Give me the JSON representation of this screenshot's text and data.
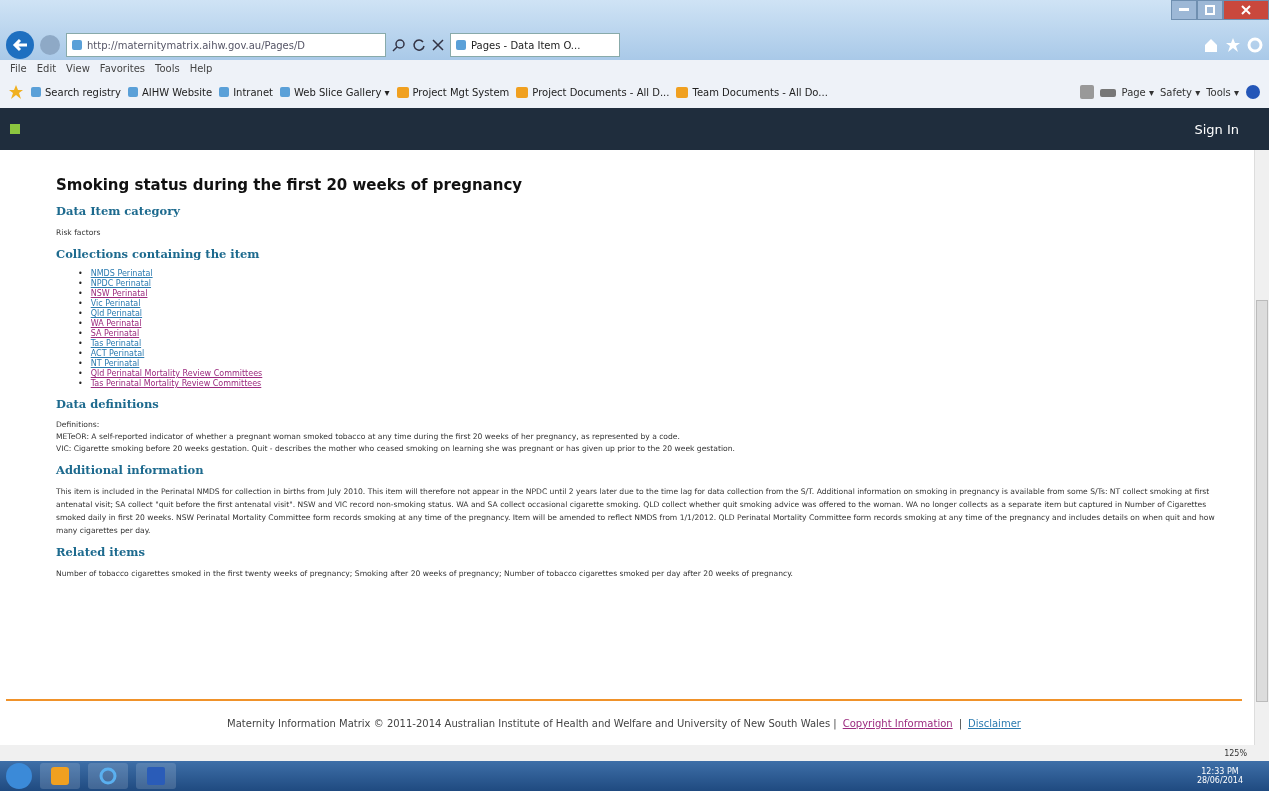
{
  "browser": {
    "address": "http://maternitymatrix.aihw.gov.au/Pages/D",
    "tab": {
      "label": "Pages - Data Item O...",
      "selected": true
    },
    "menu": [
      "File",
      "Edit",
      "View",
      "Favorites",
      "Tools",
      "Help"
    ],
    "favorites": [
      {
        "label": "Search registry",
        "kind": "page"
      },
      {
        "label": "AIHW Website",
        "kind": "page"
      },
      {
        "label": "Intranet",
        "kind": "page"
      },
      {
        "label": "Web Slice Gallery ▾",
        "kind": "page"
      },
      {
        "label": "Project Mgt System",
        "kind": "site"
      },
      {
        "label": "Project Documents - All D...",
        "kind": "site"
      },
      {
        "label": "Team Documents - All Do...",
        "kind": "site"
      }
    ],
    "commands": [
      "Page ▾",
      "Safety ▾",
      "Tools ▾"
    ]
  },
  "site_header": {
    "sign_in": "Sign In"
  },
  "page": {
    "title": "Smoking status during the first 20 weeks of pregnancy",
    "sections": [
      {
        "heading": "Data Item category",
        "kind": "text",
        "paragraphs": [
          "Risk factors"
        ]
      },
      {
        "heading": "Collections containing the item",
        "kind": "links",
        "bullet": "•",
        "links": [
          {
            "label": "NMDS Perinatal",
            "visited": false
          },
          {
            "label": "NPDC Perinatal",
            "visited": false
          },
          {
            "label": "NSW Perinatal",
            "visited": true
          },
          {
            "label": "Vic Perinatal",
            "visited": false
          },
          {
            "label": "Qld Perinatal",
            "visited": false
          },
          {
            "label": "WA Perinatal",
            "visited": true
          },
          {
            "label": "SA Perinatal",
            "visited": true
          },
          {
            "label": "Tas Perinatal",
            "visited": false
          },
          {
            "label": "ACT Perinatal",
            "visited": false
          },
          {
            "label": "NT Perinatal",
            "visited": false
          },
          {
            "label": "Qld Perinatal Mortality Review Committees",
            "visited": true
          },
          {
            "label": "Tas Perinatal Mortality Review Committees",
            "visited": true
          }
        ]
      },
      {
        "heading": "Data definitions",
        "kind": "lines",
        "paragraphs": [
          "Definitions:",
          "METeOR: A self-reported indicator of whether a pregnant woman smoked tobacco at any time during the first 20 weeks of her pregnancy, as represented by a code.",
          "VIC: Cigarette smoking before 20 weeks gestation. Quit - describes the mother who ceased smoking on learning she was pregnant or has given up prior to the 20 week gestation."
        ]
      },
      {
        "heading": "Additional information",
        "kind": "text",
        "paragraphs": [
          "This item is included in the Perinatal NMDS for collection in births from July 2010. This item will therefore not appear in the NPDC until 2 years later due to the time lag for data collection from the S/T. Additional information on smoking in pregnancy is available from some S/Ts: NT collect smoking at first antenatal visit; SA collect \"quit before the first antenatal visit\". NSW and VIC record non-smoking status. WA and SA collect occasional cigarette smoking. QLD collect whether quit smoking advice was offered to the woman. WA no longer collects as a separate item but captured in Number of Cigarettes smoked daily in first 20 weeks. NSW Perinatal Mortality Committee form records smoking at any time of the pregnancy. Item will be amended to reflect NMDS from 1/1/2012. QLD Perinatal Mortality Committee form records smoking at any time of the pregnancy and includes details on when quit and how many cigarettes per day."
        ]
      },
      {
        "heading": "Related items",
        "kind": "text",
        "paragraphs": [
          "Number of tobacco cigarettes smoked in the first twenty weeks of pregnancy; Smoking after 20 weeks of pregnancy; Number of tobacco cigarettes smoked per day after 20 weeks of pregnancy."
        ]
      }
    ]
  },
  "footer": {
    "text": "Maternity Information Matrix © 2011-2014 Australian Institute of Health and Welfare and University of New South Wales |",
    "links": [
      {
        "label": "Copyright Information",
        "visited": true
      },
      {
        "label": "Disclaimer",
        "visited": false
      }
    ],
    "separator": "|"
  },
  "status_bar": {
    "zoom": "125%"
  },
  "taskbar": {
    "time": "12:33 PM",
    "date": "28/06/2014"
  }
}
